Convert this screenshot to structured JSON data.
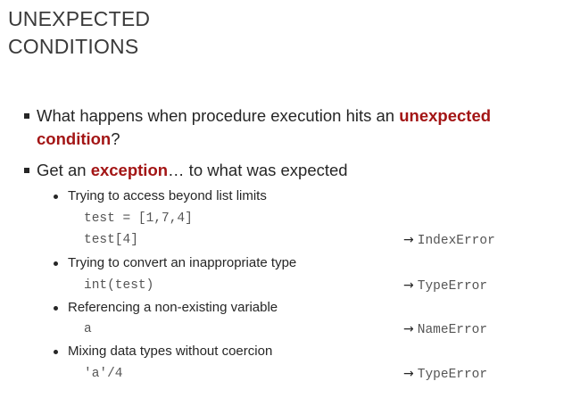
{
  "title": {
    "line1": "UNEXPECTED",
    "line2": "CONDITIONS"
  },
  "bullets": [
    {
      "pre": "What happens when procedure execution hits an ",
      "highlight": "unexpected",
      "line2_highlight": "condition",
      "line2_post": "?"
    },
    {
      "pre": "Get an ",
      "highlight": "exception",
      "post": "… to what was expected"
    }
  ],
  "cases": [
    {
      "label": "Trying to access beyond list limits",
      "code": [
        "test = [1,7,4]",
        "test[4]"
      ],
      "arrow": "→",
      "error": "IndexError"
    },
    {
      "label": "Trying to convert an inappropriate type",
      "code": [
        "int(test)"
      ],
      "arrow": "→",
      "error": "TypeError"
    },
    {
      "label": "Referencing a non-existing variable",
      "code": [
        "a"
      ],
      "arrow": "→",
      "error": "NameError"
    },
    {
      "label": "Mixing data types without coercion",
      "code": [
        "'a'/4"
      ],
      "arrow": "→",
      "error": "TypeError"
    }
  ],
  "colors": {
    "highlight": "#a31515",
    "text": "#262626",
    "code": "#555555"
  }
}
